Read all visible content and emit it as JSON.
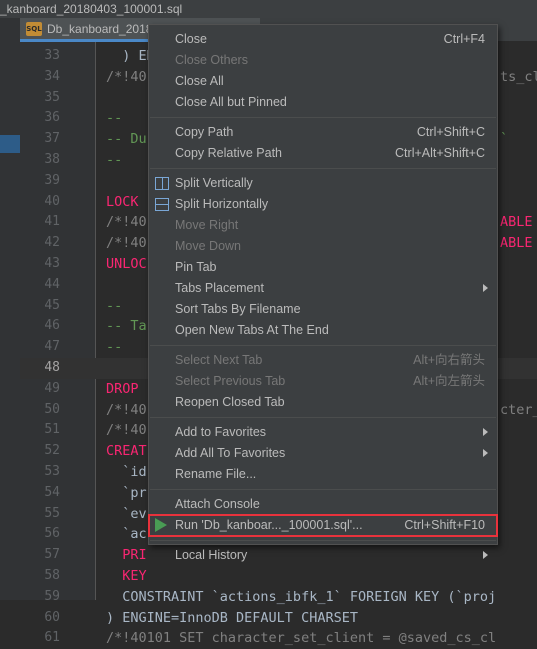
{
  "window": {
    "title": "_kanboard_20180403_100001.sql"
  },
  "tab": {
    "icon": "sql-file-icon",
    "label": "Db_kanboard_2018",
    "icon_text": "SQL"
  },
  "editor": {
    "lines": [
      {
        "num": "33",
        "text": "  ) ENG"
      },
      {
        "num": "34",
        "text": "/*!40"
      },
      {
        "num": "35",
        "text": ""
      },
      {
        "num": "36",
        "text": "--"
      },
      {
        "num": "37",
        "text": "-- Du"
      },
      {
        "num": "38",
        "text": "--"
      },
      {
        "num": "39",
        "text": ""
      },
      {
        "num": "40",
        "text": "LOCK"
      },
      {
        "num": "41",
        "text": "/*!40"
      },
      {
        "num": "42",
        "text": "/*!40"
      },
      {
        "num": "43",
        "text": "UNLOC"
      },
      {
        "num": "44",
        "text": ""
      },
      {
        "num": "45",
        "text": "--"
      },
      {
        "num": "46",
        "text": "-- Ta"
      },
      {
        "num": "47",
        "text": "--"
      },
      {
        "num": "48",
        "text": ""
      },
      {
        "num": "49",
        "text": "DROP"
      },
      {
        "num": "50",
        "text": "/*!40"
      },
      {
        "num": "51",
        "text": "/*!40"
      },
      {
        "num": "52",
        "text": "CREAT"
      },
      {
        "num": "53",
        "text": "  `id"
      },
      {
        "num": "54",
        "text": "  `pr"
      },
      {
        "num": "55",
        "text": "  `ev"
      },
      {
        "num": "56",
        "text": "  `ac"
      },
      {
        "num": "57",
        "text": "  PRI"
      },
      {
        "num": "58",
        "text": "  KEY"
      },
      {
        "num": "59",
        "text": "  CONSTRAINT `actions_ibfk_1` FOREIGN KEY (`proj"
      },
      {
        "num": "60",
        "text": ") ENGINE=InnoDB DEFAULT CHARSET"
      },
      {
        "num": "61",
        "text": "/*!40101 SET character_set_client = @saved_cs_cl"
      }
    ],
    "right_fragments": {
      "r34": "ts_cl",
      "r37": "`",
      "r41": "ABLE",
      "r42": "ABLE",
      "r50": "cter_"
    }
  },
  "context_menu": {
    "items": [
      {
        "type": "item",
        "name": "close",
        "label": "Close",
        "shortcut": "Ctrl+F4",
        "disabled": false
      },
      {
        "type": "item",
        "name": "close-others",
        "label": "Close Others",
        "shortcut": "",
        "disabled": true
      },
      {
        "type": "item",
        "name": "close-all",
        "label": "Close All",
        "shortcut": "",
        "disabled": false
      },
      {
        "type": "item",
        "name": "close-all-but-pinned",
        "label": "Close All but Pinned",
        "shortcut": "",
        "disabled": false
      },
      {
        "type": "separator"
      },
      {
        "type": "item",
        "name": "copy-path",
        "label": "Copy Path",
        "shortcut": "Ctrl+Shift+C",
        "disabled": false
      },
      {
        "type": "item",
        "name": "copy-relative-path",
        "label": "Copy Relative Path",
        "shortcut": "Ctrl+Alt+Shift+C",
        "disabled": false
      },
      {
        "type": "separator"
      },
      {
        "type": "item",
        "name": "split-vertically",
        "label": "Split Vertically",
        "shortcut": "",
        "disabled": false,
        "icon": "split-vertical-icon"
      },
      {
        "type": "item",
        "name": "split-horizontally",
        "label": "Split Horizontally",
        "shortcut": "",
        "disabled": false,
        "icon": "split-horizontal-icon"
      },
      {
        "type": "item",
        "name": "move-right",
        "label": "Move Right",
        "shortcut": "",
        "disabled": true
      },
      {
        "type": "item",
        "name": "move-down",
        "label": "Move Down",
        "shortcut": "",
        "disabled": true
      },
      {
        "type": "item",
        "name": "pin-tab",
        "label": "Pin Tab",
        "shortcut": "",
        "disabled": false
      },
      {
        "type": "item",
        "name": "tabs-placement",
        "label": "Tabs Placement",
        "shortcut": "",
        "disabled": false,
        "submenu": true
      },
      {
        "type": "item",
        "name": "sort-tabs-by-filename",
        "label": "Sort Tabs By Filename",
        "shortcut": "",
        "disabled": false
      },
      {
        "type": "item",
        "name": "open-new-tabs-at-end",
        "label": "Open New Tabs At The End",
        "shortcut": "",
        "disabled": false
      },
      {
        "type": "separator"
      },
      {
        "type": "item",
        "name": "select-next-tab",
        "label": "Select Next Tab",
        "shortcut": "Alt+向右箭头",
        "disabled": true
      },
      {
        "type": "item",
        "name": "select-previous-tab",
        "label": "Select Previous Tab",
        "shortcut": "Alt+向左箭头",
        "disabled": true
      },
      {
        "type": "item",
        "name": "reopen-closed-tab",
        "label": "Reopen Closed Tab",
        "shortcut": "",
        "disabled": false
      },
      {
        "type": "separator"
      },
      {
        "type": "item",
        "name": "add-to-favorites",
        "label": "Add to Favorites",
        "shortcut": "",
        "disabled": false,
        "submenu": true
      },
      {
        "type": "item",
        "name": "add-all-to-favorites",
        "label": "Add All To Favorites",
        "shortcut": "",
        "disabled": false,
        "submenu": true
      },
      {
        "type": "item",
        "name": "rename-file",
        "label": "Rename File...",
        "shortcut": "",
        "disabled": false
      },
      {
        "type": "separator"
      },
      {
        "type": "item",
        "name": "attach-console",
        "label": "Attach Console",
        "shortcut": "",
        "disabled": false
      },
      {
        "type": "item",
        "name": "run-file",
        "label": "Run 'Db_kanboar..._100001.sql'...",
        "shortcut": "Ctrl+Shift+F10",
        "disabled": false,
        "icon": "run-icon",
        "highlighted_outline": "#e8323c"
      },
      {
        "type": "separator"
      },
      {
        "type": "item",
        "name": "local-history",
        "label": "Local History",
        "shortcut": "",
        "disabled": false,
        "submenu": true
      }
    ]
  },
  "colors": {
    "editor_bg": "#2b2b2b",
    "menu_bg": "#3c3f41",
    "keyword_orange": "#cc7832",
    "keyword_pink": "#f92672",
    "comment_green": "#629755",
    "highlight_red": "#e8323c"
  }
}
